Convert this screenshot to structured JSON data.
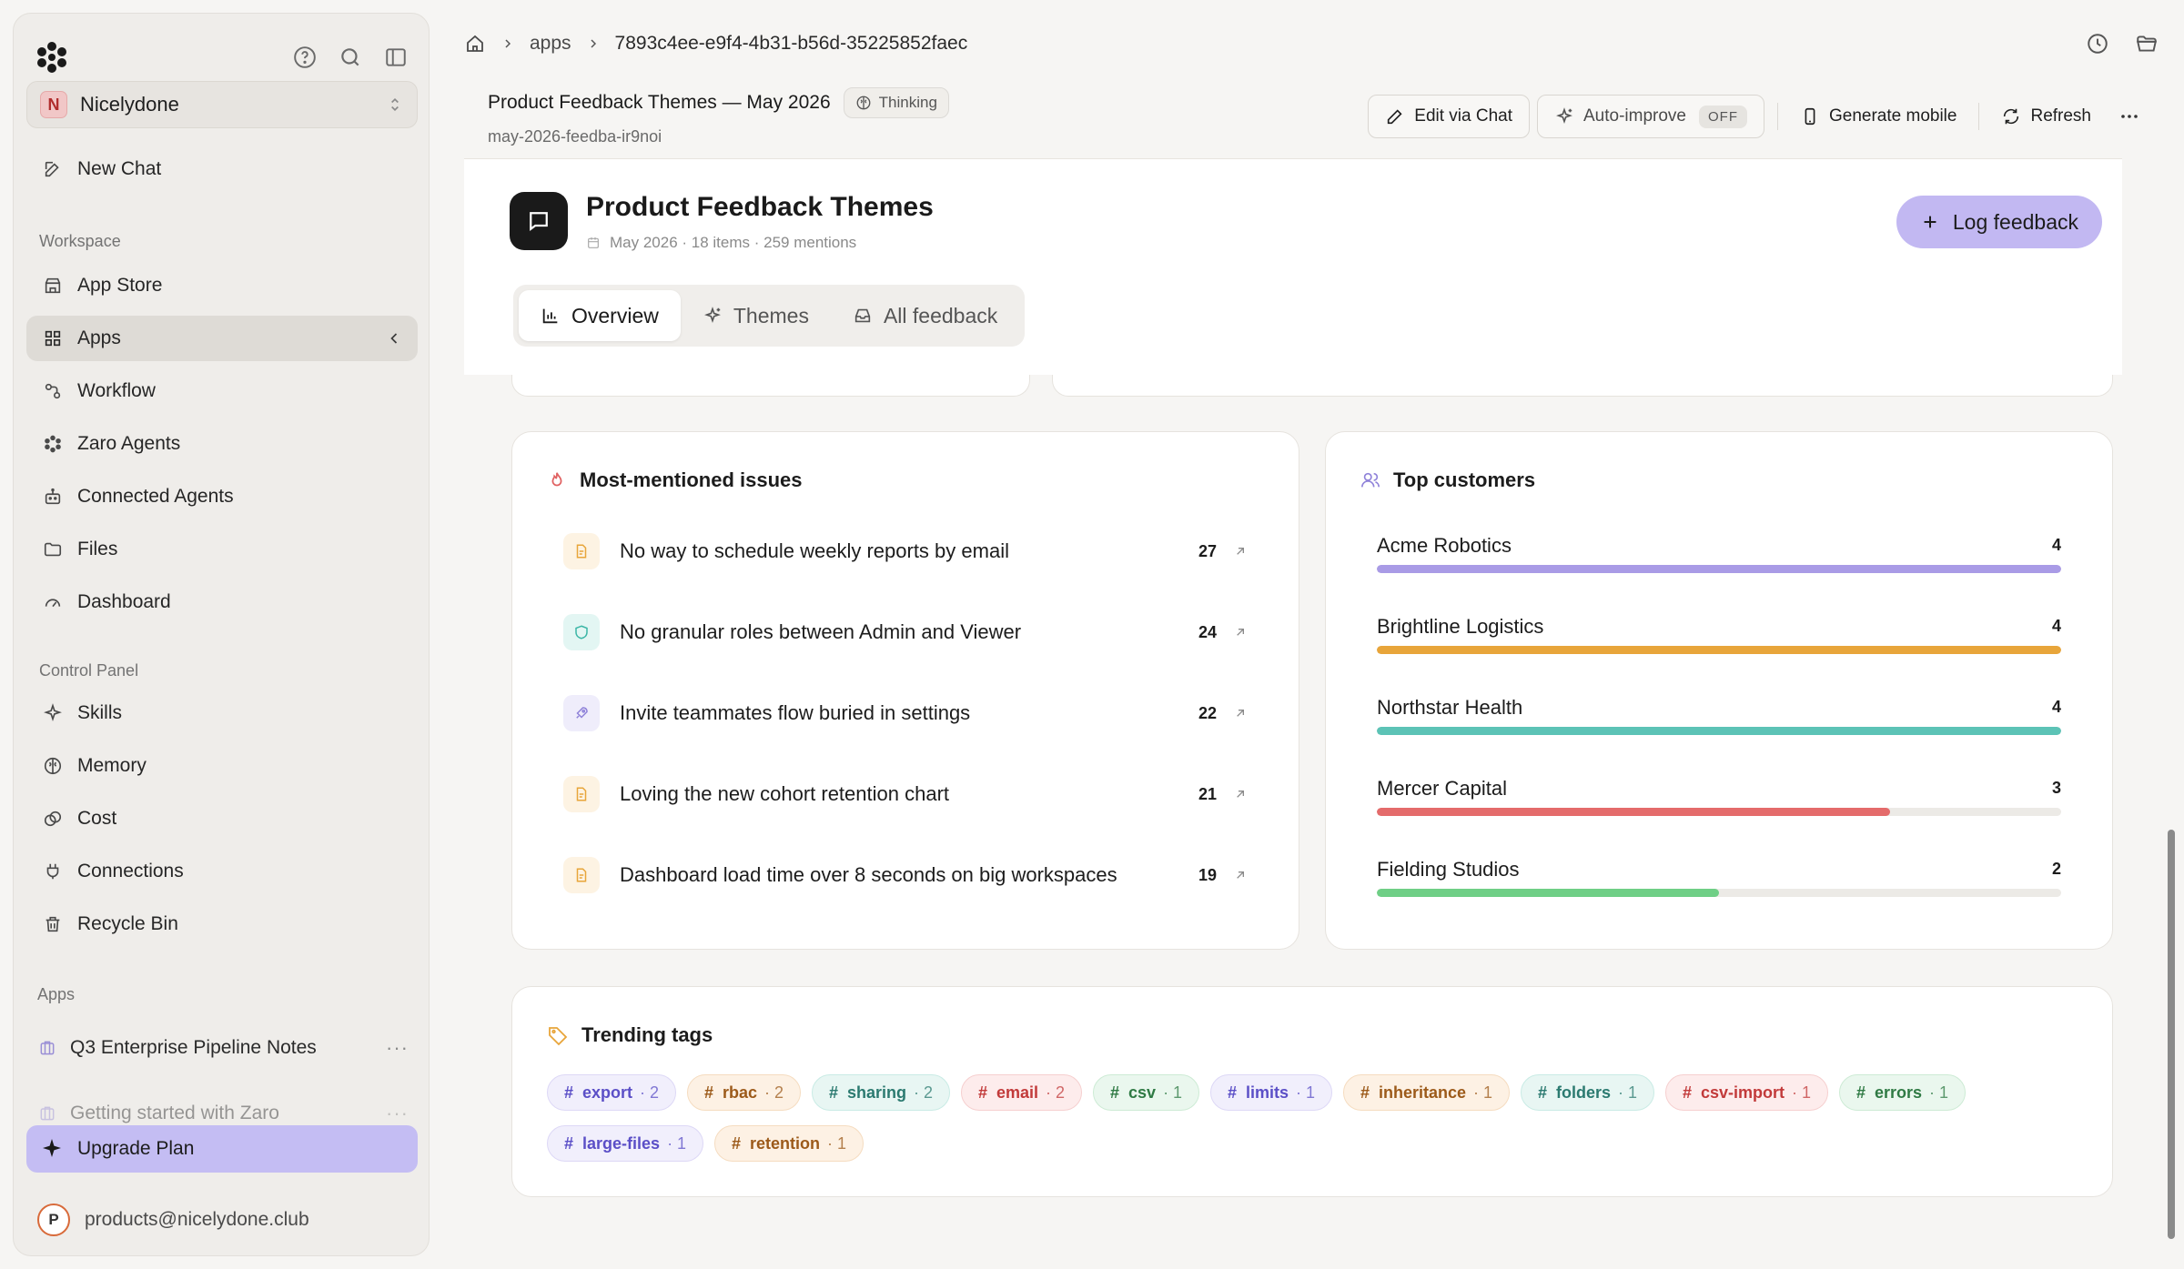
{
  "sidebar": {
    "workspace": "Nicelydone",
    "workspace_initial": "N",
    "new_chat": "New Chat",
    "workspace_label": "Workspace",
    "workspace_items": [
      {
        "label": "App Store",
        "icon": "store-icon"
      },
      {
        "label": "Apps",
        "icon": "grid-icon",
        "active": true
      },
      {
        "label": "Workflow",
        "icon": "workflow-icon"
      },
      {
        "label": "Zaro Agents",
        "icon": "agents-icon"
      },
      {
        "label": "Connected Agents",
        "icon": "robot-icon"
      },
      {
        "label": "Files",
        "icon": "folder-icon"
      },
      {
        "label": "Dashboard",
        "icon": "gauge-icon"
      }
    ],
    "control_label": "Control Panel",
    "control_items": [
      {
        "label": "Skills",
        "icon": "sparkle-icon"
      },
      {
        "label": "Memory",
        "icon": "brain-icon"
      },
      {
        "label": "Cost",
        "icon": "coins-icon"
      },
      {
        "label": "Connections",
        "icon": "plug-icon"
      },
      {
        "label": "Recycle Bin",
        "icon": "trash-icon"
      }
    ],
    "apps_label": "Apps",
    "apps": [
      {
        "label": "Q3 Enterprise Pipeline Notes"
      },
      {
        "label": "Getting started with Zaro"
      }
    ],
    "upgrade": "Upgrade Plan",
    "account_email": "products@nicelydone.club",
    "account_initial": "P"
  },
  "breadcrumb": {
    "parent": "apps",
    "id": "7893c4ee-e9f4-4b31-b56d-35225852faec"
  },
  "app_header": {
    "title": "Product Feedback Themes — May 2026",
    "status": "Thinking",
    "slug": "may-2026-feedba-ir9noi",
    "edit_chat": "Edit via Chat",
    "auto_improve": "Auto-improve",
    "auto_improve_state": "OFF",
    "generate_mobile": "Generate mobile",
    "refresh": "Refresh"
  },
  "page": {
    "title": "Product Feedback Themes",
    "meta": "May 2026 · 18 items · 259 mentions",
    "log_button": "Log feedback",
    "tabs": [
      {
        "label": "Overview",
        "active": true
      },
      {
        "label": "Themes"
      },
      {
        "label": "All feedback"
      }
    ]
  },
  "issues": {
    "title": "Most-mentioned issues",
    "items": [
      {
        "text": "No way to schedule weekly reports by email",
        "count": "27",
        "icon": "document-icon",
        "color": "#e8a53a",
        "bg": "#fdf3e3"
      },
      {
        "text": "No granular roles between Admin and Viewer",
        "count": "24",
        "icon": "shield-icon",
        "color": "#3bb6a6",
        "bg": "#e3f6f3"
      },
      {
        "text": "Invite teammates flow buried in settings",
        "count": "22",
        "icon": "rocket-icon",
        "color": "#8f82d9",
        "bg": "#efedfb"
      },
      {
        "text": "Loving the new cohort retention chart",
        "count": "21",
        "icon": "document-icon",
        "color": "#e8a53a",
        "bg": "#fdf3e3"
      },
      {
        "text": "Dashboard load time over 8 seconds on big workspaces",
        "count": "19",
        "icon": "document-icon",
        "color": "#e8a53a",
        "bg": "#fdf3e3"
      }
    ]
  },
  "customers": {
    "title": "Top customers",
    "max": 4,
    "items": [
      {
        "name": "Acme Robotics",
        "count": "4",
        "value": 4,
        "color": "#a99be6"
      },
      {
        "name": "Brightline Logistics",
        "count": "4",
        "value": 4,
        "color": "#e8a53a"
      },
      {
        "name": "Northstar Health",
        "count": "4",
        "value": 4,
        "color": "#5cc3b6"
      },
      {
        "name": "Mercer Capital",
        "count": "3",
        "value": 3,
        "color": "#e46b6b"
      },
      {
        "name": "Fielding Studios",
        "count": "2",
        "value": 2,
        "color": "#6fcf86"
      }
    ]
  },
  "tags": {
    "title": "Trending tags",
    "items": [
      {
        "name": "export",
        "count": "· 2",
        "color": "#5b4fc7",
        "bg": "#f1effc",
        "border": "#ddd8f6"
      },
      {
        "name": "rbac",
        "count": "· 2",
        "color": "#9c5a1a",
        "bg": "#fdf1e4",
        "border": "#f5dcc0"
      },
      {
        "name": "sharing",
        "count": "· 2",
        "color": "#2b7a70",
        "bg": "#e8f6f3",
        "border": "#c9ebe5"
      },
      {
        "name": "email",
        "count": "· 2",
        "color": "#c23a3a",
        "bg": "#fdecec",
        "border": "#f6cfcf"
      },
      {
        "name": "csv",
        "count": "· 1",
        "color": "#2f7a44",
        "bg": "#eaf7ee",
        "border": "#cdebd5"
      },
      {
        "name": "limits",
        "count": "· 1",
        "color": "#5b4fc7",
        "bg": "#f1effc",
        "border": "#ddd8f6"
      },
      {
        "name": "inheritance",
        "count": "· 1",
        "color": "#9c5a1a",
        "bg": "#fdf1e4",
        "border": "#f5dcc0"
      },
      {
        "name": "folders",
        "count": "· 1",
        "color": "#2b7a70",
        "bg": "#e8f6f3",
        "border": "#c9ebe5"
      },
      {
        "name": "csv-import",
        "count": "· 1",
        "color": "#c23a3a",
        "bg": "#fdecec",
        "border": "#f6cfcf"
      },
      {
        "name": "errors",
        "count": "· 1",
        "color": "#2f7a44",
        "bg": "#eaf7ee",
        "border": "#cdebd5"
      },
      {
        "name": "large-files",
        "count": "· 1",
        "color": "#5b4fc7",
        "bg": "#f1effc",
        "border": "#ddd8f6"
      },
      {
        "name": "retention",
        "count": "· 1",
        "color": "#9c5a1a",
        "bg": "#fdf1e4",
        "border": "#f5dcc0"
      }
    ]
  },
  "colors": {
    "accent": "#c4bdf3",
    "sidebar_bg": "#efedea",
    "page_bg": "#f6f5f3"
  }
}
